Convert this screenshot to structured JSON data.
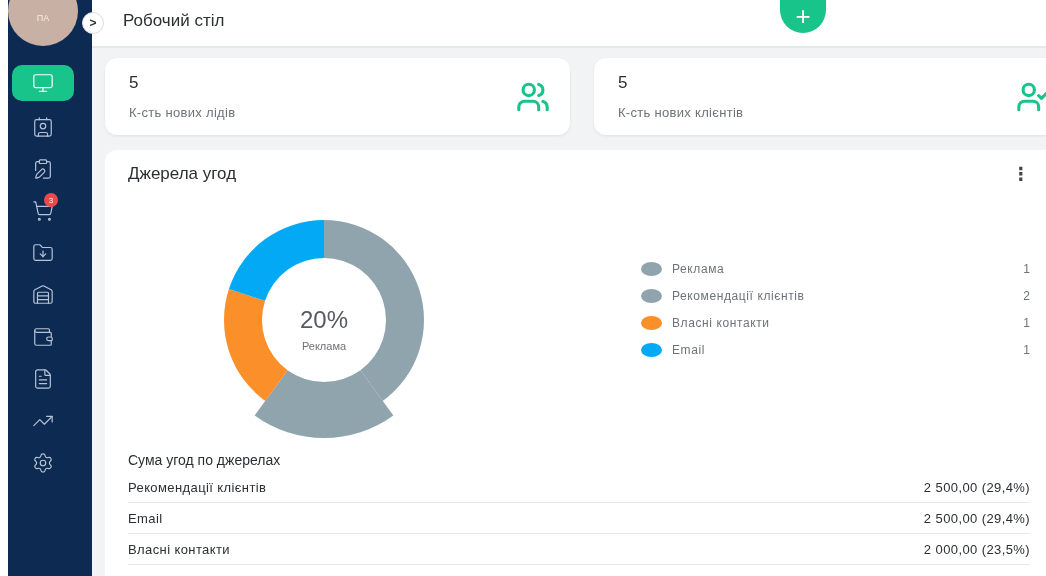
{
  "sidebar": {
    "avatar": "ПА",
    "toggle": ">",
    "items": [
      {
        "kind": "monitor",
        "selected": true
      },
      {
        "kind": "contacts",
        "selected": false
      },
      {
        "kind": "clipboard",
        "selected": false
      },
      {
        "kind": "cart",
        "selected": false,
        "badge": "3"
      },
      {
        "kind": "folder",
        "selected": false
      },
      {
        "kind": "warehouse",
        "selected": false
      },
      {
        "kind": "wallet",
        "selected": false
      },
      {
        "kind": "document",
        "selected": false
      },
      {
        "kind": "chart",
        "selected": false
      },
      {
        "kind": "settings",
        "selected": false
      }
    ]
  },
  "header": {
    "title": "Робочий стіл",
    "add_button": "+"
  },
  "stats": [
    {
      "value": "5",
      "label": "К-сть нових лідів",
      "kind": "leads"
    },
    {
      "value": "5",
      "label": "К-сть нових клієнтів",
      "kind": "clients"
    }
  ],
  "sources_card": {
    "title": "Джерела угод",
    "menu": "⋮",
    "center": {
      "value": "20%",
      "label": "Реклама"
    },
    "chart_data": {
      "type": "donut",
      "categories": [
        "Реклама",
        "Рекомендації клієнтів",
        "Власні контакти",
        "Email"
      ],
      "values": [
        20,
        40,
        20,
        20
      ]
    },
    "legend": [
      {
        "count": "1",
        "color": "#90a4ae"
      },
      {
        "count": "2",
        "color": "#90a4ae"
      },
      {
        "count": "1",
        "color": "#fb8f2a"
      },
      {
        "count": "1",
        "color": "#03a9f4"
      }
    ],
    "sums_title": "Сума угод по джерелах",
    "sums": [
      {
        "label": "Рекомендації клієнтів",
        "amount": "2 500,00 (29,4%)"
      },
      {
        "label": "Email",
        "amount": "2 500,00 (29,4%)"
      },
      {
        "label": "Власні контакти",
        "amount": "2 000,00 (23,5%)"
      }
    ]
  }
}
